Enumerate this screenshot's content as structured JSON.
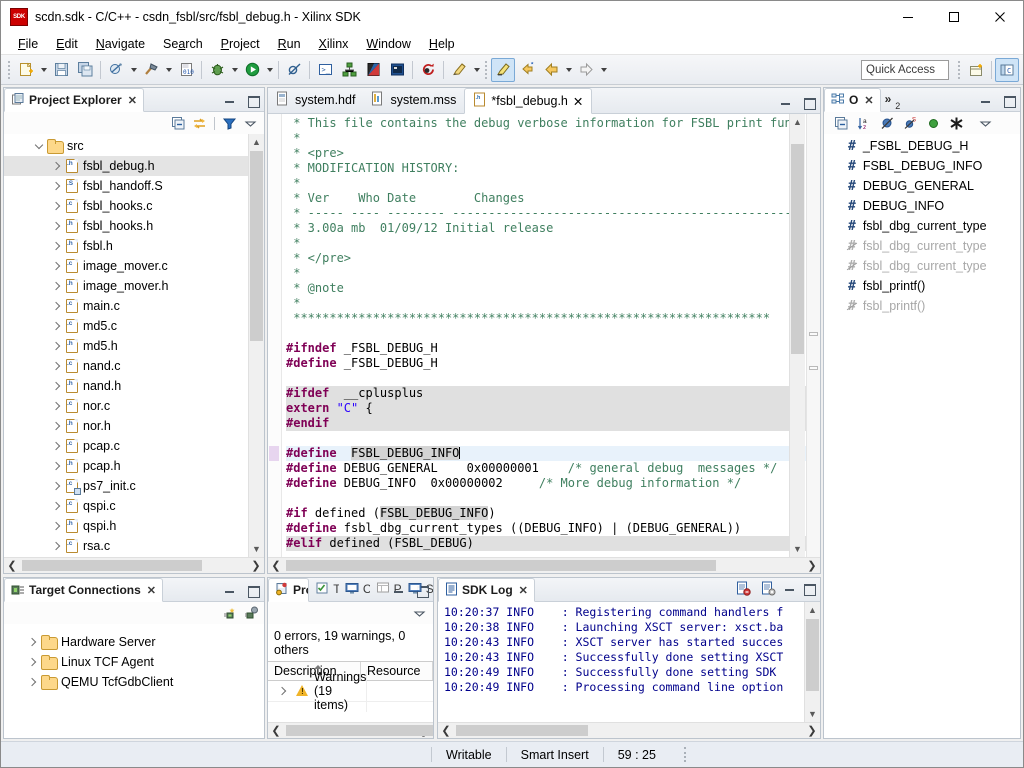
{
  "window": {
    "title": "scdn.sdk - C/C++ - csdn_fsbl/src/fsbl_debug.h - Xilinx SDK",
    "app_icon": "sdk-icon",
    "minimize": "minimize-icon",
    "maximize": "maximize-icon",
    "close": "close-icon"
  },
  "menubar": {
    "items": [
      {
        "label": "File",
        "mnemonic": "F"
      },
      {
        "label": "Edit",
        "mnemonic": "E"
      },
      {
        "label": "Navigate",
        "mnemonic": "N"
      },
      {
        "label": "Search",
        "mnemonic": "a"
      },
      {
        "label": "Project",
        "mnemonic": "P"
      },
      {
        "label": "Run",
        "mnemonic": "R"
      },
      {
        "label": "Xilinx",
        "mnemonic": "X"
      },
      {
        "label": "Window",
        "mnemonic": "W"
      },
      {
        "label": "Help",
        "mnemonic": "H"
      }
    ]
  },
  "toolbar": {
    "quick_access_placeholder": "Quick Access",
    "quick_access_value": "",
    "buttons": [
      "new-file-icon",
      "save-icon",
      "save-all-icon",
      "program-fpga-icon",
      "build-hammer-icon",
      "binary-file-icon",
      "debug-bug-icon",
      "run-icon",
      "skip-breakpoints-icon",
      "terminal-icon",
      "system-debugger-icon",
      "flash-icon",
      "board-icon",
      "refresh-red-icon",
      "marker-pen-icon",
      "highlight-pen-icon",
      "back-history-icon",
      "back-arrow-icon",
      "forward-arrow-icon"
    ],
    "perspective_open": "open-perspective-icon",
    "perspective_current": "c-cpp-perspective-icon"
  },
  "project_explorer": {
    "title": "Project Explorer",
    "close": "close-icon",
    "toolbar": [
      "collapse-all-icon",
      "link-with-editor-icon",
      "filter-icon",
      "view-menu-icon"
    ],
    "minimize": "minimize-icon",
    "maximize": "maximize-icon",
    "tree": [
      {
        "label": "src",
        "icon": "folder-icon",
        "indent": 1,
        "expander": "expanded",
        "selected": false
      },
      {
        "label": "fsbl_debug.h",
        "icon": "h-file-icon",
        "indent": 2,
        "expander": "collapsed",
        "selected": true
      },
      {
        "label": "fsbl_handoff.S",
        "icon": "s-file-icon",
        "indent": 2,
        "expander": "collapsed",
        "selected": false
      },
      {
        "label": "fsbl_hooks.c",
        "icon": "c-file-icon",
        "indent": 2,
        "expander": "collapsed",
        "selected": false
      },
      {
        "label": "fsbl_hooks.h",
        "icon": "h-file-icon",
        "indent": 2,
        "expander": "collapsed",
        "selected": false
      },
      {
        "label": "fsbl.h",
        "icon": "h-file-icon",
        "indent": 2,
        "expander": "collapsed",
        "selected": false
      },
      {
        "label": "image_mover.c",
        "icon": "c-file-icon",
        "indent": 2,
        "expander": "collapsed",
        "selected": false
      },
      {
        "label": "image_mover.h",
        "icon": "h-file-icon",
        "indent": 2,
        "expander": "collapsed",
        "selected": false
      },
      {
        "label": "main.c",
        "icon": "c-file-icon",
        "indent": 2,
        "expander": "collapsed",
        "selected": false
      },
      {
        "label": "md5.c",
        "icon": "c-file-icon",
        "indent": 2,
        "expander": "collapsed",
        "selected": false
      },
      {
        "label": "md5.h",
        "icon": "h-file-icon",
        "indent": 2,
        "expander": "collapsed",
        "selected": false
      },
      {
        "label": "nand.c",
        "icon": "c-file-icon",
        "indent": 2,
        "expander": "collapsed",
        "selected": false
      },
      {
        "label": "nand.h",
        "icon": "h-file-icon",
        "indent": 2,
        "expander": "collapsed",
        "selected": false
      },
      {
        "label": "nor.c",
        "icon": "c-file-icon",
        "indent": 2,
        "expander": "collapsed",
        "selected": false
      },
      {
        "label": "nor.h",
        "icon": "h-file-icon",
        "indent": 2,
        "expander": "collapsed",
        "selected": false
      },
      {
        "label": "pcap.c",
        "icon": "c-file-icon",
        "indent": 2,
        "expander": "collapsed",
        "selected": false
      },
      {
        "label": "pcap.h",
        "icon": "h-file-icon",
        "indent": 2,
        "expander": "collapsed",
        "selected": false
      },
      {
        "label": "ps7_init.c",
        "icon": "c-file-linked-icon",
        "indent": 2,
        "expander": "collapsed",
        "selected": false
      },
      {
        "label": "qspi.c",
        "icon": "c-file-icon",
        "indent": 2,
        "expander": "collapsed",
        "selected": false
      },
      {
        "label": "qspi.h",
        "icon": "h-file-icon",
        "indent": 2,
        "expander": "collapsed",
        "selected": false
      },
      {
        "label": "rsa.c",
        "icon": "c-file-icon",
        "indent": 2,
        "expander": "collapsed",
        "selected": false
      }
    ]
  },
  "target_connections": {
    "title": "Target Connections",
    "close": "close-icon",
    "toolbar": [
      "new-connection-icon",
      "disconnect-icon"
    ],
    "items": [
      {
        "label": "Hardware Server",
        "icon": "folder-icon"
      },
      {
        "label": "Linux TCF Agent",
        "icon": "folder-icon"
      },
      {
        "label": "QEMU TcfGdbClient",
        "icon": "folder-icon"
      }
    ]
  },
  "editor": {
    "tabs": [
      {
        "label": "system.hdf",
        "icon": "hdf-file-icon",
        "selected": false,
        "dirty": false
      },
      {
        "label": "system.mss",
        "icon": "mss-file-icon",
        "selected": false,
        "dirty": false
      },
      {
        "label": "*fsbl_debug.h",
        "icon": "h-file-icon",
        "selected": true,
        "dirty": true
      }
    ],
    "minimize": "minimize-icon",
    "maximize": "maximize-icon",
    "lines": [
      {
        "segments": [
          {
            "t": " * This file contains the debug verbose information for FSBL print func",
            "c": "cmt"
          }
        ]
      },
      {
        "segments": [
          {
            "t": " *",
            "c": "cmt"
          }
        ]
      },
      {
        "segments": [
          {
            "t": " * <pre>",
            "c": "cmt"
          }
        ]
      },
      {
        "segments": [
          {
            "t": " * MODIFICATION HISTORY:",
            "c": "cmt"
          }
        ]
      },
      {
        "segments": [
          {
            "t": " *",
            "c": "cmt"
          }
        ]
      },
      {
        "segments": [
          {
            "t": " * Ver    Who Date        Changes",
            "c": "cmt"
          }
        ]
      },
      {
        "segments": [
          {
            "t": " * ----- ---- -------- -------------------------------------------------",
            "c": "cmt"
          }
        ]
      },
      {
        "segments": [
          {
            "t": " * 3.00a mb  01/09/12 Initial release",
            "c": "cmt"
          }
        ]
      },
      {
        "segments": [
          {
            "t": " *",
            "c": "cmt"
          }
        ]
      },
      {
        "segments": [
          {
            "t": " * </pre>",
            "c": "cmt"
          }
        ]
      },
      {
        "segments": [
          {
            "t": " *",
            "c": "cmt"
          }
        ]
      },
      {
        "segments": [
          {
            "t": " * @note",
            "c": "cmt"
          }
        ]
      },
      {
        "segments": [
          {
            "t": " *",
            "c": "cmt"
          }
        ]
      },
      {
        "segments": [
          {
            "t": " ******************************************************************",
            "c": "cmt"
          }
        ]
      },
      {
        "segments": [
          {
            "t": "",
            "c": "plain"
          }
        ]
      },
      {
        "segments": [
          {
            "t": "#ifndef",
            "c": "pre"
          },
          {
            "t": " _FSBL_DEBUG_H",
            "c": "plain"
          }
        ]
      },
      {
        "segments": [
          {
            "t": "#define",
            "c": "pre"
          },
          {
            "t": " _FSBL_DEBUG_H",
            "c": "plain"
          }
        ]
      },
      {
        "segments": [
          {
            "t": "",
            "c": "plain"
          }
        ]
      },
      {
        "inactive": true,
        "segments": [
          {
            "t": "#ifdef",
            "c": "pre"
          },
          {
            "t": "  __cplusplus",
            "c": "plain"
          }
        ]
      },
      {
        "inactive": true,
        "segments": [
          {
            "t": "extern ",
            "c": "pre"
          },
          {
            "t": "\"C\"",
            "c": "str"
          },
          {
            "t": " {",
            "c": "plain"
          }
        ]
      },
      {
        "inactive": true,
        "segments": [
          {
            "t": "#endif",
            "c": "pre"
          }
        ]
      },
      {
        "segments": [
          {
            "t": "",
            "c": "plain"
          }
        ]
      },
      {
        "current": true,
        "marker": true,
        "segments": [
          {
            "t": "#define",
            "c": "pre"
          },
          {
            "t": "  ",
            "c": "plain"
          },
          {
            "t": "FSBL_DEBUG_INFO",
            "c": "plain hl"
          },
          {
            "t": "|",
            "c": "caret"
          }
        ]
      },
      {
        "segments": [
          {
            "t": "#define",
            "c": "pre"
          },
          {
            "t": " DEBUG_GENERAL    0x00000001",
            "c": "plain"
          },
          {
            "t": "    /* general debug  messages */",
            "c": "cmt"
          }
        ]
      },
      {
        "segments": [
          {
            "t": "#define",
            "c": "pre"
          },
          {
            "t": " DEBUG_INFO  0x00000002",
            "c": "plain"
          },
          {
            "t": "     /* More debug information */",
            "c": "cmt"
          }
        ]
      },
      {
        "segments": [
          {
            "t": "",
            "c": "plain"
          }
        ]
      },
      {
        "segments": [
          {
            "t": "#if",
            "c": "pre"
          },
          {
            "t": " defined (",
            "c": "plain"
          },
          {
            "t": "FSBL_DEBUG_INFO",
            "c": "plain hl"
          },
          {
            "t": ")",
            "c": "plain"
          }
        ]
      },
      {
        "segments": [
          {
            "t": "#define",
            "c": "pre"
          },
          {
            "t": " fsbl_dbg_current_types ((DEBUG_INFO) | (DEBUG_GENERAL))",
            "c": "plain"
          }
        ]
      },
      {
        "inactive": true,
        "segments": [
          {
            "t": "#elif",
            "c": "pre"
          },
          {
            "t": " defined (FSBL_DEBUG)",
            "c": "plain"
          }
        ]
      }
    ]
  },
  "outline": {
    "title": "O",
    "title_full": "Outline",
    "close": "close-icon",
    "overflow_label": "2",
    "minimize": "minimize-icon",
    "maximize": "maximize-icon",
    "toolbar": [
      "collapse-all-icon",
      "sort-az-icon",
      "hide-fields-icon",
      "hide-static-icon",
      "hide-nonpublic-icon",
      "hide-macros-icon",
      "view-menu-icon"
    ],
    "items": [
      {
        "label": "_FSBL_DEBUG_H",
        "icon": "macro-icon",
        "dim": false,
        "struck": false
      },
      {
        "label": "FSBL_DEBUG_INFO",
        "icon": "macro-icon",
        "dim": false,
        "struck": false
      },
      {
        "label": "DEBUG_GENERAL",
        "icon": "macro-icon",
        "dim": false,
        "struck": false
      },
      {
        "label": "DEBUG_INFO",
        "icon": "macro-icon",
        "dim": false,
        "struck": false
      },
      {
        "label": "fsbl_dbg_current_type",
        "icon": "macro-icon",
        "dim": false,
        "struck": false
      },
      {
        "label": "fsbl_dbg_current_type",
        "icon": "macro-inactive-icon",
        "dim": true,
        "struck": true
      },
      {
        "label": "fsbl_dbg_current_type",
        "icon": "macro-inactive-icon",
        "dim": true,
        "struck": true
      },
      {
        "label": "fsbl_printf()",
        "icon": "macro-icon",
        "dim": false,
        "struck": false
      },
      {
        "label": "fsbl_printf()",
        "icon": "macro-inactive-icon",
        "dim": true,
        "struck": true
      }
    ]
  },
  "problems": {
    "tabs": [
      {
        "label": "Pro...",
        "icon": "problems-icon",
        "selected": true
      },
      {
        "label": "Ta...",
        "icon": "tasks-icon",
        "selected": false
      },
      {
        "label": "Co...",
        "icon": "console-icon",
        "selected": false
      },
      {
        "label": "Pro...",
        "icon": "properties-icon",
        "selected": false
      },
      {
        "label": "SD...",
        "icon": "sdk-terminal-icon",
        "selected": false
      }
    ],
    "view_menu": "view-menu-icon",
    "minimize": "minimize-icon",
    "maximize": "maximize-icon",
    "summary": "0 errors, 19 warnings, 0 others",
    "columns": [
      "Description",
      "Resource"
    ],
    "rows": [
      {
        "description": "Warnings (19 items)",
        "resource": "",
        "icon": "warning-icon",
        "expander": "collapsed"
      }
    ]
  },
  "sdk_log": {
    "title": "SDK Log",
    "close": "close-icon",
    "toolbar": [
      "clear-log-icon",
      "log-settings-icon"
    ],
    "minimize": "minimize-icon",
    "maximize": "maximize-icon",
    "entries": [
      {
        "time": "10:20:37",
        "level": "INFO",
        "message": ": Registering command handlers f"
      },
      {
        "time": "10:20:38",
        "level": "INFO",
        "message": ": Launching XSCT server: xsct.ba"
      },
      {
        "time": "10:20:43",
        "level": "INFO",
        "message": ": XSCT server has started succes"
      },
      {
        "time": "10:20:43",
        "level": "INFO",
        "message": ": Successfully done setting XSCT"
      },
      {
        "time": "10:20:49",
        "level": "INFO",
        "message": ": Successfully done setting SDK "
      },
      {
        "time": "10:20:49",
        "level": "INFO",
        "message": ": Processing command line option"
      }
    ]
  },
  "statusbar": {
    "writable": "Writable",
    "insert_mode": "Smart Insert",
    "cursor_position": "59 : 25"
  },
  "colors": {
    "comment": "#3f7f5f",
    "preprocessor": "#7f0055",
    "string": "#2a00ff",
    "current_line": "#e8f2fb",
    "inactive_block": "#e0e0e0",
    "selection": "#d4d4d4",
    "log_text": "#00008b",
    "accent": "#cfe4f7"
  }
}
